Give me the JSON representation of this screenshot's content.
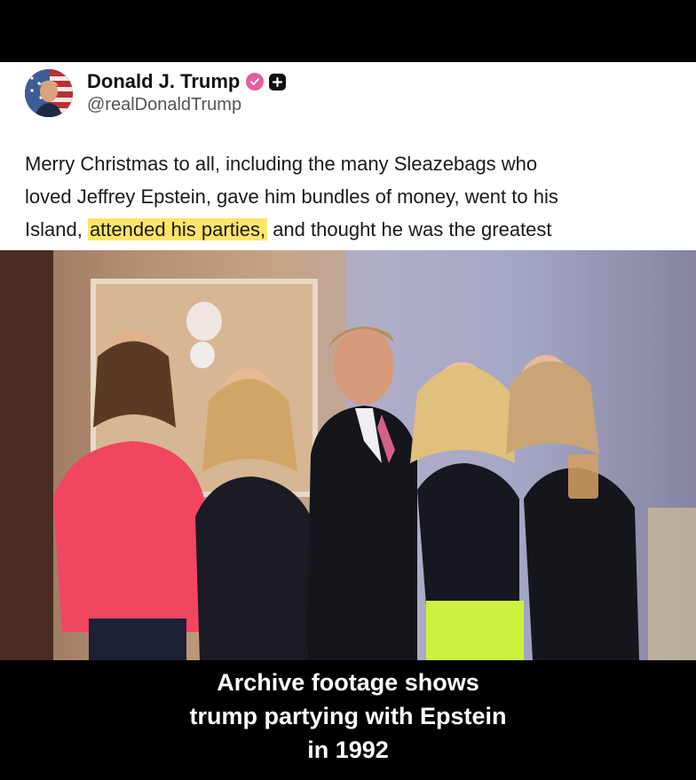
{
  "post": {
    "author": {
      "display_name": "Donald J. Trump",
      "handle": "@realDonaldTrump",
      "avatar_icon": "flag-portrait-avatar",
      "verified_color": "#e55ba3"
    },
    "text": {
      "line1": "Merry Christmas to all, including the many Sleazebags who",
      "line2": "loved Jeffrey Epstein, gave him bundles of money, went to his",
      "line3_before": "Island, ",
      "line3_highlight": "attended his parties,",
      "line3_after": " and thought he was the greatest"
    },
    "highlight_color": "#fde56a"
  },
  "video": {
    "caption_line1": "Archive footage shows",
    "caption_line2": "trump partying with Epstein",
    "caption_line3": "in 1992"
  }
}
